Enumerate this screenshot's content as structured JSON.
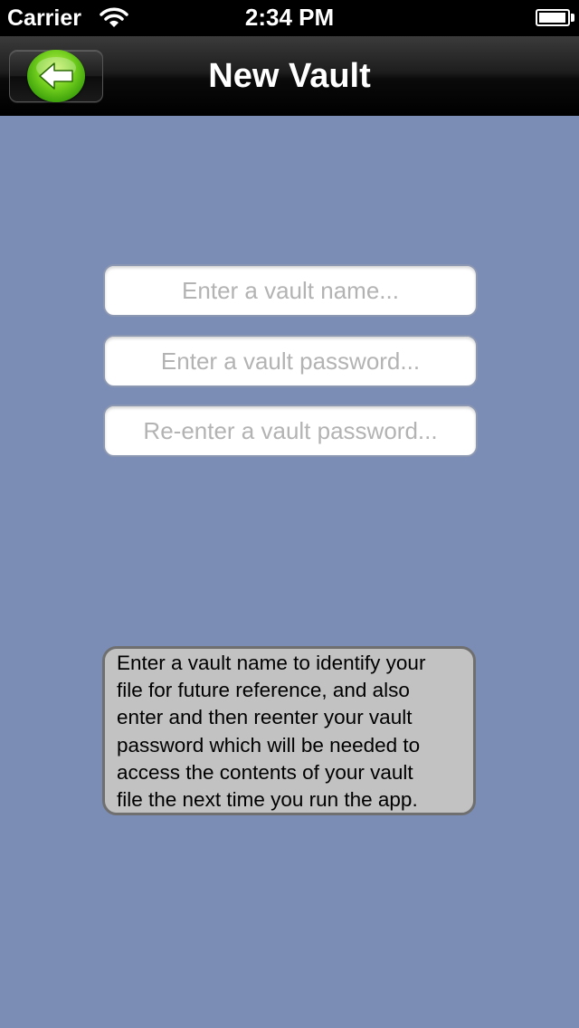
{
  "status_bar": {
    "carrier": "Carrier",
    "time": "2:34 PM",
    "battery_level": 0.95
  },
  "nav_bar": {
    "title": "New Vault",
    "back_icon": "green-back-arrow-icon"
  },
  "form": {
    "vault_name_placeholder": "Enter a vault name...",
    "vault_password_placeholder": "Enter a vault password...",
    "vault_password_confirm_placeholder": "Re-enter a vault password..."
  },
  "info": {
    "lines": [
      "Enter a vault name to identify your",
      "file for future reference, and also",
      "enter and then reenter your vault",
      "password which will be needed to",
      "access the contents of your vault",
      "file the next time you run the app."
    ]
  },
  "colors": {
    "background": "#7b8db5",
    "info_box": "#c2c2c2",
    "back_button_green": "#6fcc1c"
  }
}
